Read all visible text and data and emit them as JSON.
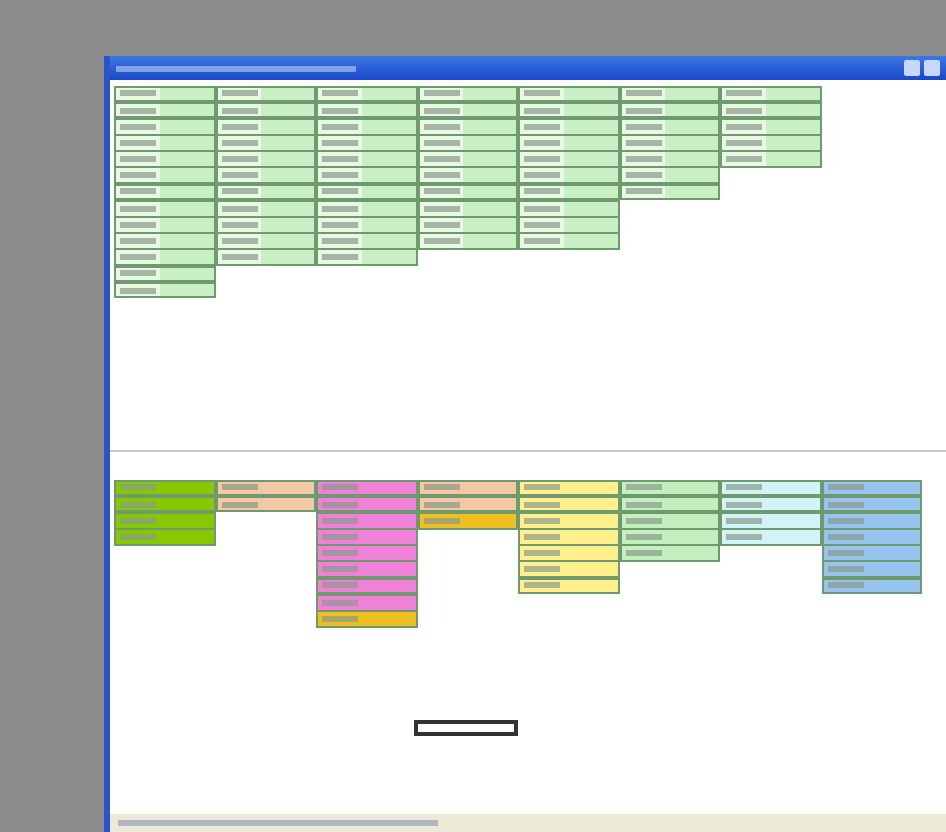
{
  "top_columns": [
    {
      "cells": [
        {
          "kind": "cell"
        },
        {
          "kind": "cell"
        },
        {
          "kind": "cell"
        },
        {
          "kind": "cell"
        },
        {
          "kind": "cell"
        },
        {
          "kind": "cell"
        },
        {
          "kind": "cell"
        },
        {
          "kind": "cell"
        },
        {
          "kind": "cell"
        },
        {
          "kind": "cell"
        },
        {
          "kind": "cell"
        },
        {
          "kind": "cell"
        },
        {
          "kind": "cell"
        }
      ]
    },
    {
      "cells": [
        {
          "kind": "cell"
        },
        {
          "kind": "cell"
        },
        {
          "kind": "cell"
        },
        {
          "kind": "cell"
        },
        {
          "kind": "cell"
        },
        {
          "kind": "cell"
        },
        {
          "kind": "cell"
        },
        {
          "kind": "cell"
        },
        {
          "kind": "cell"
        },
        {
          "kind": "cell"
        },
        {
          "kind": "cell"
        }
      ]
    },
    {
      "cells": [
        {
          "kind": "cell"
        },
        {
          "kind": "cell"
        },
        {
          "kind": "cell"
        },
        {
          "kind": "cell"
        },
        {
          "kind": "cell"
        },
        {
          "kind": "cell"
        },
        {
          "kind": "cell"
        },
        {
          "kind": "cell"
        },
        {
          "kind": "cell"
        },
        {
          "kind": "cell"
        },
        {
          "kind": "cell"
        }
      ]
    },
    {
      "cells": [
        {
          "kind": "cell"
        },
        {
          "kind": "cell"
        },
        {
          "kind": "cell"
        },
        {
          "kind": "cell"
        },
        {
          "kind": "cell"
        },
        {
          "kind": "cell"
        },
        {
          "kind": "cell"
        },
        {
          "kind": "cell"
        },
        {
          "kind": "cell"
        },
        {
          "kind": "cell"
        }
      ]
    },
    {
      "cells": [
        {
          "kind": "cell"
        },
        {
          "kind": "cell"
        },
        {
          "kind": "cell"
        },
        {
          "kind": "cell"
        },
        {
          "kind": "cell"
        },
        {
          "kind": "cell"
        },
        {
          "kind": "cell"
        },
        {
          "kind": "cell"
        },
        {
          "kind": "cell"
        },
        {
          "kind": "cell"
        }
      ]
    },
    {
      "cells": [
        {
          "kind": "cell"
        },
        {
          "kind": "cell"
        },
        {
          "kind": "cell"
        },
        {
          "kind": "cell"
        },
        {
          "kind": "cell"
        },
        {
          "kind": "cell"
        },
        {
          "kind": "cell"
        }
      ]
    },
    {
      "cells": [
        {
          "kind": "cell"
        },
        {
          "kind": "cell"
        },
        {
          "kind": "cell"
        },
        {
          "kind": "cell"
        },
        {
          "kind": "cell"
        }
      ]
    }
  ],
  "bottom_columns": [
    {
      "cells": [
        {
          "color": "#88c800"
        },
        {
          "color": "#88c800"
        },
        {
          "color": "#88c800"
        },
        {
          "color": "#88c800"
        }
      ]
    },
    {
      "cells": [
        {
          "color": "#f4c8a4"
        },
        {
          "color": "#f4c8a4"
        }
      ]
    },
    {
      "cells": [
        {
          "color": "#f080d8"
        },
        {
          "color": "#f080d8"
        },
        {
          "color": "#f080d8"
        },
        {
          "color": "#f080d8"
        },
        {
          "color": "#f080d8"
        },
        {
          "color": "#f080d8"
        },
        {
          "color": "#f080d8"
        },
        {
          "color": "#f080d8"
        },
        {
          "color": "#f0c020"
        }
      ]
    },
    {
      "cells": [
        {
          "color": "#f4c8a4"
        },
        {
          "color": "#f4c8a4"
        },
        {
          "color": "#f0c020"
        }
      ]
    },
    {
      "cells": [
        {
          "color": "#fff08c"
        },
        {
          "color": "#fff08c"
        },
        {
          "color": "#fff08c"
        },
        {
          "color": "#fff08c"
        },
        {
          "color": "#fff08c"
        },
        {
          "color": "#fff08c"
        },
        {
          "color": "#fff08c"
        }
      ]
    },
    {
      "cells": [
        {
          "color": "#c4f0c0"
        },
        {
          "color": "#c4f0c0"
        },
        {
          "color": "#c4f0c0"
        },
        {
          "color": "#c4f0c0"
        },
        {
          "color": "#c4f0c0"
        }
      ]
    },
    {
      "cells": [
        {
          "color": "#d0f4f8"
        },
        {
          "color": "#d0f4f8"
        },
        {
          "color": "#d0f4f8"
        },
        {
          "color": "#d0f4f8"
        }
      ]
    },
    {
      "cells": [
        {
          "color": "#98c4f0"
        },
        {
          "color": "#98c4f0"
        },
        {
          "color": "#98c4f0"
        },
        {
          "color": "#98c4f0"
        },
        {
          "color": "#98c4f0"
        },
        {
          "color": "#98c4f0"
        },
        {
          "color": "#98c4f0"
        }
      ]
    }
  ]
}
